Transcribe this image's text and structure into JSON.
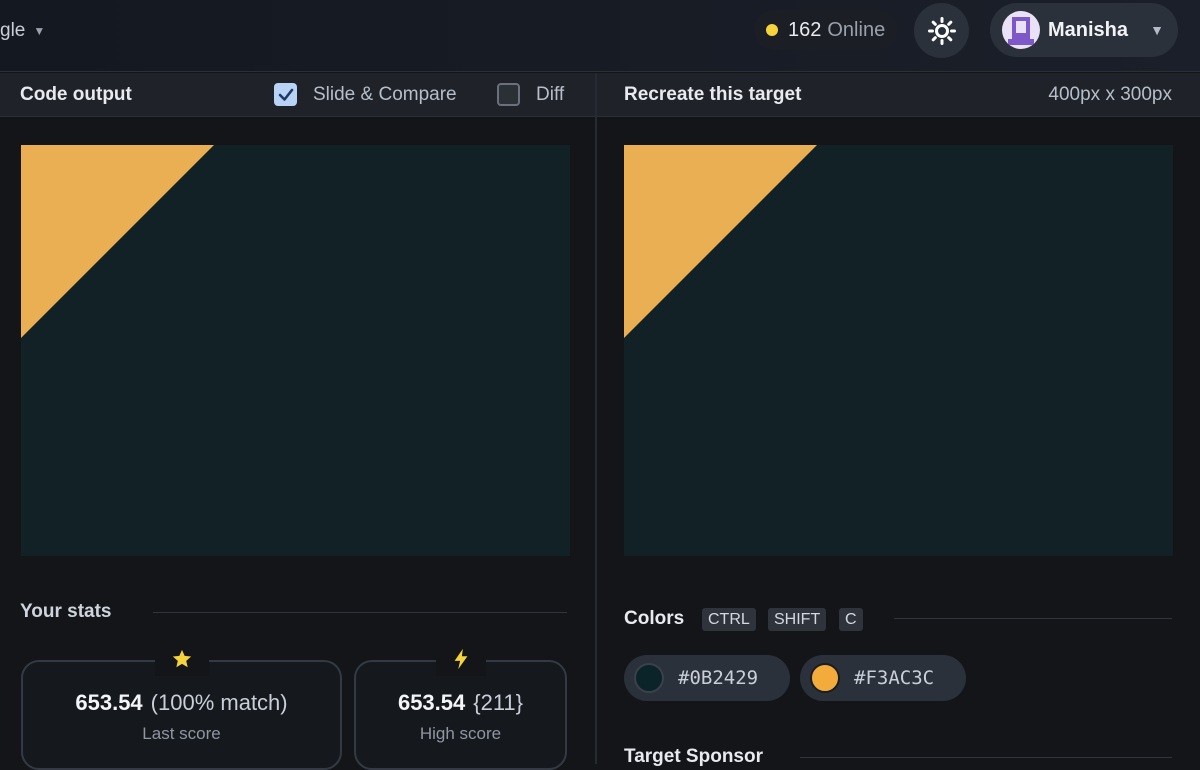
{
  "topbar": {
    "breadcrumb": "gle",
    "online_count": "162",
    "online_label": "Online",
    "user_name": "Manisha"
  },
  "left_panel": {
    "title": "Code output",
    "slide_compare_label": "Slide & Compare",
    "slide_compare_checked": true,
    "diff_label": "Diff",
    "diff_checked": false
  },
  "right_panel": {
    "title": "Recreate this target",
    "dimensions": "400px x 300px"
  },
  "stats": {
    "title": "Your stats",
    "last_score": {
      "value": "653.54",
      "extra": "(100% match)",
      "label": "Last score",
      "icon": "star-icon"
    },
    "high_score": {
      "value": "653.54",
      "extra": "{211}",
      "label": "High score",
      "icon": "lightning-icon"
    }
  },
  "colors": {
    "title": "Colors",
    "shortcut_keys": [
      "CTRL",
      "SHIFT",
      "C"
    ],
    "swatches": [
      {
        "hex": "#0B2429",
        "label": "#0B2429"
      },
      {
        "hex": "#F3AC3C",
        "label": "#F3AC3C"
      }
    ]
  },
  "sponsor": {
    "title": "Target Sponsor"
  },
  "palette": {
    "canvas_bg": "#112125",
    "triangle": "#EAAF52",
    "accent_check": "#B9D3F7",
    "online_dot": "#F5D33C"
  }
}
